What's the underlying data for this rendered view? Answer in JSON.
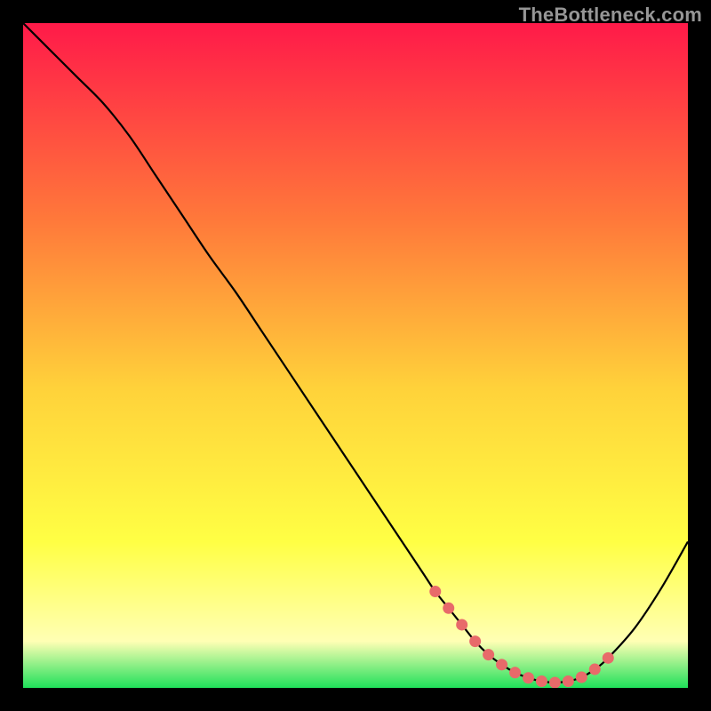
{
  "watermark": "TheBottleneck.com",
  "colors": {
    "gradient_top": "#ff1a49",
    "gradient_mid1": "#ff7a3a",
    "gradient_mid2": "#ffd23a",
    "gradient_mid3": "#ffff44",
    "gradient_mid4": "#ffffb4",
    "gradient_bottom": "#1fe05a",
    "curve": "#000000",
    "marker": "#e86a6a"
  },
  "chart_data": {
    "type": "line",
    "title": "",
    "xlabel": "",
    "ylabel": "",
    "xlim": [
      0,
      100
    ],
    "ylim": [
      0,
      100
    ],
    "grid": false,
    "legend": false,
    "series": [
      {
        "name": "bottleneck-curve",
        "x": [
          0,
          4,
          8,
          12,
          16,
          20,
          24,
          28,
          32,
          36,
          40,
          44,
          48,
          52,
          56,
          60,
          62,
          64,
          66,
          68,
          70,
          72,
          74,
          76,
          78,
          80,
          82,
          84,
          86,
          88,
          92,
          96,
          100
        ],
        "y": [
          100,
          96,
          92,
          88,
          83,
          77,
          71,
          65,
          59.5,
          53.5,
          47.5,
          41.5,
          35.5,
          29.5,
          23.5,
          17.5,
          14.5,
          12,
          9.5,
          7,
          5,
          3.5,
          2.3,
          1.5,
          1,
          0.8,
          1,
          1.6,
          2.8,
          4.5,
          9,
          15,
          22
        ]
      }
    ],
    "markers": {
      "name": "optimum-range",
      "x": [
        62,
        64,
        66,
        68,
        70,
        72,
        74,
        76,
        78,
        80,
        82,
        84,
        86,
        88
      ],
      "y": [
        14.5,
        12,
        9.5,
        7,
        5,
        3.5,
        2.3,
        1.5,
        1,
        0.8,
        1,
        1.6,
        2.8,
        4.5
      ]
    }
  }
}
